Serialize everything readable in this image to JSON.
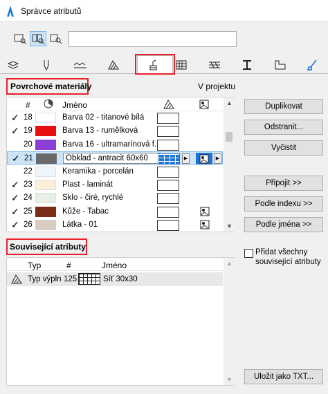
{
  "window": {
    "title": "Správce atributů"
  },
  "search": {
    "value": ""
  },
  "surfaces_section": {
    "title": "Povrchové materiály",
    "in_project": "V projektu",
    "columns": {
      "number": "#",
      "name": "Jméno"
    },
    "rows": [
      {
        "checked": true,
        "num": "18",
        "color": "#ffffff",
        "name": "Barva 02 - titanové bílá",
        "texture": false,
        "selected": false
      },
      {
        "checked": true,
        "num": "19",
        "color": "#e80f0f",
        "name": "Barva 13 - rumělková",
        "texture": false,
        "selected": false
      },
      {
        "checked": false,
        "num": "20",
        "color": "#8b3fd6",
        "name": "Barva 16 - ultramarínová f...",
        "texture": false,
        "selected": false
      },
      {
        "checked": true,
        "num": "21",
        "color": "#6a6a6a",
        "name": "Obklad - antracit 60x60",
        "texture": true,
        "selected": true
      },
      {
        "checked": false,
        "num": "22",
        "color": "#eef6fb",
        "name": "Keramika - porcelán",
        "texture": false,
        "selected": false
      },
      {
        "checked": true,
        "num": "23",
        "color": "#fbefdc",
        "name": "Plast - laminát",
        "texture": false,
        "selected": false
      },
      {
        "checked": true,
        "num": "24",
        "color": "#e6f0e6",
        "name": "Sklo - čiré, rychlé",
        "texture": false,
        "selected": false
      },
      {
        "checked": true,
        "num": "25",
        "color": "#7b2d17",
        "name": "Kůže - Tabac",
        "texture": true,
        "selected": false
      },
      {
        "checked": true,
        "num": "26",
        "color": "#d8cdc2",
        "name": "Látka - 01",
        "texture": true,
        "selected": false
      }
    ]
  },
  "buttons": {
    "duplicate": "Duplikovat",
    "remove": "Odstranit...",
    "clear": "Vyčistit",
    "append": "Připojit >>",
    "by_index": "Podle indexu >>",
    "by_name": "Podle jména >>",
    "save_txt": "Uložit jako TXT..."
  },
  "related_section": {
    "title": "Související atributy",
    "columns": {
      "type": "Typ",
      "number": "#",
      "name": "Jméno"
    },
    "rows": [
      {
        "type": "Typ výpln",
        "num": "125",
        "name": "Síť 30x30"
      }
    ]
  },
  "add_related": {
    "label": "Přidat všechny související atributy",
    "checked": false
  }
}
